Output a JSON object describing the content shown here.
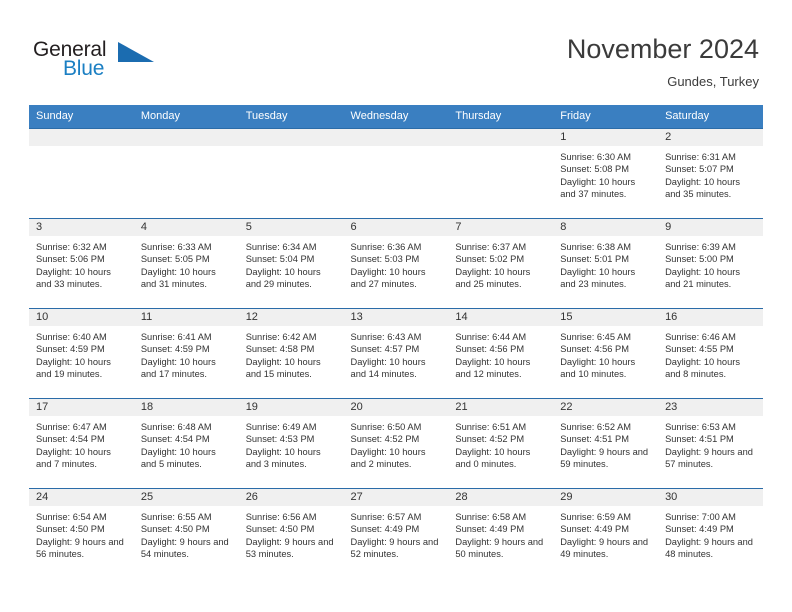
{
  "brand": {
    "name_part1": "General",
    "name_part2": "Blue",
    "triangle_color": "#1b6cb0",
    "blue_color": "#1b7fc3"
  },
  "header": {
    "title": "November 2024",
    "location": "Gundes, Turkey"
  },
  "theme": {
    "header_row_bg": "#3a7fc1",
    "row_divider": "#2b6ca8",
    "daynum_bg": "#f0f0f0",
    "text": "#333333"
  },
  "weekday_headers": [
    "Sunday",
    "Monday",
    "Tuesday",
    "Wednesday",
    "Thursday",
    "Friday",
    "Saturday"
  ],
  "labels": {
    "sunrise": "Sunrise:",
    "sunset": "Sunset:",
    "daylight": "Daylight:"
  },
  "weeks": [
    [
      {
        "date": "",
        "empty": true
      },
      {
        "date": "",
        "empty": true
      },
      {
        "date": "",
        "empty": true
      },
      {
        "date": "",
        "empty": true
      },
      {
        "date": "",
        "empty": true
      },
      {
        "date": "1",
        "sunrise": "Sunrise: 6:30 AM",
        "sunset": "Sunset: 5:08 PM",
        "daylight": "Daylight: 10 hours and 37 minutes."
      },
      {
        "date": "2",
        "sunrise": "Sunrise: 6:31 AM",
        "sunset": "Sunset: 5:07 PM",
        "daylight": "Daylight: 10 hours and 35 minutes."
      }
    ],
    [
      {
        "date": "3",
        "sunrise": "Sunrise: 6:32 AM",
        "sunset": "Sunset: 5:06 PM",
        "daylight": "Daylight: 10 hours and 33 minutes."
      },
      {
        "date": "4",
        "sunrise": "Sunrise: 6:33 AM",
        "sunset": "Sunset: 5:05 PM",
        "daylight": "Daylight: 10 hours and 31 minutes."
      },
      {
        "date": "5",
        "sunrise": "Sunrise: 6:34 AM",
        "sunset": "Sunset: 5:04 PM",
        "daylight": "Daylight: 10 hours and 29 minutes."
      },
      {
        "date": "6",
        "sunrise": "Sunrise: 6:36 AM",
        "sunset": "Sunset: 5:03 PM",
        "daylight": "Daylight: 10 hours and 27 minutes."
      },
      {
        "date": "7",
        "sunrise": "Sunrise: 6:37 AM",
        "sunset": "Sunset: 5:02 PM",
        "daylight": "Daylight: 10 hours and 25 minutes."
      },
      {
        "date": "8",
        "sunrise": "Sunrise: 6:38 AM",
        "sunset": "Sunset: 5:01 PM",
        "daylight": "Daylight: 10 hours and 23 minutes."
      },
      {
        "date": "9",
        "sunrise": "Sunrise: 6:39 AM",
        "sunset": "Sunset: 5:00 PM",
        "daylight": "Daylight: 10 hours and 21 minutes."
      }
    ],
    [
      {
        "date": "10",
        "sunrise": "Sunrise: 6:40 AM",
        "sunset": "Sunset: 4:59 PM",
        "daylight": "Daylight: 10 hours and 19 minutes."
      },
      {
        "date": "11",
        "sunrise": "Sunrise: 6:41 AM",
        "sunset": "Sunset: 4:59 PM",
        "daylight": "Daylight: 10 hours and 17 minutes."
      },
      {
        "date": "12",
        "sunrise": "Sunrise: 6:42 AM",
        "sunset": "Sunset: 4:58 PM",
        "daylight": "Daylight: 10 hours and 15 minutes."
      },
      {
        "date": "13",
        "sunrise": "Sunrise: 6:43 AM",
        "sunset": "Sunset: 4:57 PM",
        "daylight": "Daylight: 10 hours and 14 minutes."
      },
      {
        "date": "14",
        "sunrise": "Sunrise: 6:44 AM",
        "sunset": "Sunset: 4:56 PM",
        "daylight": "Daylight: 10 hours and 12 minutes."
      },
      {
        "date": "15",
        "sunrise": "Sunrise: 6:45 AM",
        "sunset": "Sunset: 4:56 PM",
        "daylight": "Daylight: 10 hours and 10 minutes."
      },
      {
        "date": "16",
        "sunrise": "Sunrise: 6:46 AM",
        "sunset": "Sunset: 4:55 PM",
        "daylight": "Daylight: 10 hours and 8 minutes."
      }
    ],
    [
      {
        "date": "17",
        "sunrise": "Sunrise: 6:47 AM",
        "sunset": "Sunset: 4:54 PM",
        "daylight": "Daylight: 10 hours and 7 minutes."
      },
      {
        "date": "18",
        "sunrise": "Sunrise: 6:48 AM",
        "sunset": "Sunset: 4:54 PM",
        "daylight": "Daylight: 10 hours and 5 minutes."
      },
      {
        "date": "19",
        "sunrise": "Sunrise: 6:49 AM",
        "sunset": "Sunset: 4:53 PM",
        "daylight": "Daylight: 10 hours and 3 minutes."
      },
      {
        "date": "20",
        "sunrise": "Sunrise: 6:50 AM",
        "sunset": "Sunset: 4:52 PM",
        "daylight": "Daylight: 10 hours and 2 minutes."
      },
      {
        "date": "21",
        "sunrise": "Sunrise: 6:51 AM",
        "sunset": "Sunset: 4:52 PM",
        "daylight": "Daylight: 10 hours and 0 minutes."
      },
      {
        "date": "22",
        "sunrise": "Sunrise: 6:52 AM",
        "sunset": "Sunset: 4:51 PM",
        "daylight": "Daylight: 9 hours and 59 minutes."
      },
      {
        "date": "23",
        "sunrise": "Sunrise: 6:53 AM",
        "sunset": "Sunset: 4:51 PM",
        "daylight": "Daylight: 9 hours and 57 minutes."
      }
    ],
    [
      {
        "date": "24",
        "sunrise": "Sunrise: 6:54 AM",
        "sunset": "Sunset: 4:50 PM",
        "daylight": "Daylight: 9 hours and 56 minutes."
      },
      {
        "date": "25",
        "sunrise": "Sunrise: 6:55 AM",
        "sunset": "Sunset: 4:50 PM",
        "daylight": "Daylight: 9 hours and 54 minutes."
      },
      {
        "date": "26",
        "sunrise": "Sunrise: 6:56 AM",
        "sunset": "Sunset: 4:50 PM",
        "daylight": "Daylight: 9 hours and 53 minutes."
      },
      {
        "date": "27",
        "sunrise": "Sunrise: 6:57 AM",
        "sunset": "Sunset: 4:49 PM",
        "daylight": "Daylight: 9 hours and 52 minutes."
      },
      {
        "date": "28",
        "sunrise": "Sunrise: 6:58 AM",
        "sunset": "Sunset: 4:49 PM",
        "daylight": "Daylight: 9 hours and 50 minutes."
      },
      {
        "date": "29",
        "sunrise": "Sunrise: 6:59 AM",
        "sunset": "Sunset: 4:49 PM",
        "daylight": "Daylight: 9 hours and 49 minutes."
      },
      {
        "date": "30",
        "sunrise": "Sunrise: 7:00 AM",
        "sunset": "Sunset: 4:49 PM",
        "daylight": "Daylight: 9 hours and 48 minutes."
      }
    ]
  ]
}
